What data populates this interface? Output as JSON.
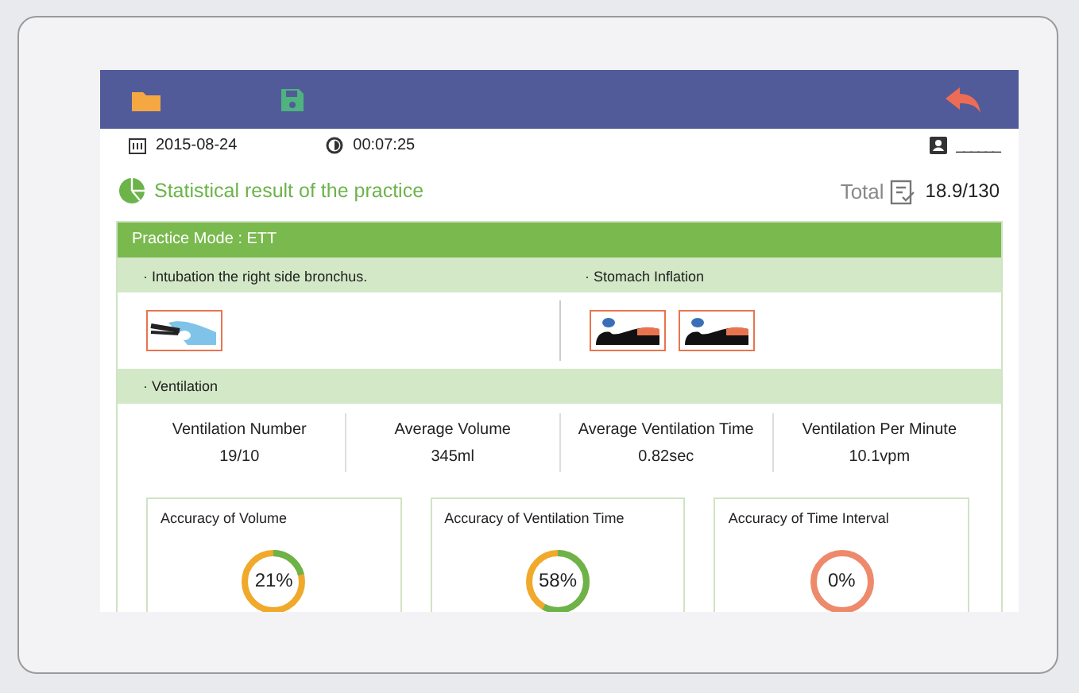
{
  "info": {
    "date": "2015-08-24",
    "duration": "00:07:25",
    "user": "______"
  },
  "title": "Statistical result of the practice",
  "total": {
    "label": "Total",
    "value": "18.9/130"
  },
  "mode": "Practice Mode : ETT",
  "errors": [
    {
      "label": "· Intubation the right side bronchus.",
      "images": [
        {
          "kind": "tube"
        }
      ]
    },
    {
      "label": "· Stomach Inflation",
      "images": [
        {
          "kind": "body"
        },
        {
          "kind": "body"
        }
      ]
    }
  ],
  "ventilation": {
    "label": "· Ventilation",
    "stats": [
      {
        "name": "Ventilation Number",
        "value": "19/10"
      },
      {
        "name": "Average Volume",
        "value": "345ml"
      },
      {
        "name": "Average Ventilation Time",
        "value": "0.82sec"
      },
      {
        "name": "Ventilation Per Minute",
        "value": "10.1vpm"
      }
    ]
  },
  "accuracy": [
    {
      "title": "Accuracy of Volume",
      "reading": "21%",
      "level": 0.21,
      "color": "#f0a92a"
    },
    {
      "title": "Accuracy of Ventilation Time",
      "reading": "58%",
      "level": 0.58,
      "color": "#f0a92a"
    },
    {
      "title": "Accuracy of Time Interval",
      "reading": "0%",
      "level": 0,
      "color": "#ee8a6c"
    }
  ]
}
